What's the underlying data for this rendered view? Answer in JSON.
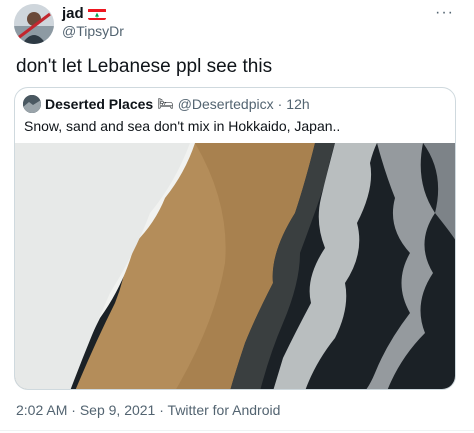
{
  "author": {
    "name": "jad",
    "handle": "@TipsyDr",
    "flag": "lebanon-flag"
  },
  "tweet": {
    "text": "don't let Lebanese ppl see this",
    "more_icon": "more-options-icon"
  },
  "quote": {
    "name": "Deserted Places",
    "emoji": "🛏",
    "handle": "@Desertedpicx",
    "separator": "·",
    "time": "12h",
    "text": "Snow, sand and sea don't mix in Hokkaido, Japan..",
    "image_alt": "aerial photo of snow, sand and sea meeting on a beach"
  },
  "footer": {
    "time": "2:02 AM",
    "sep1": "·",
    "date": "Sep 9, 2021",
    "sep2": "·",
    "source": "Twitter for Android"
  },
  "colors": {
    "flag_red": "#ee161f",
    "flag_green": "#00a651",
    "text_primary": "#0f1419",
    "text_secondary": "#536471",
    "border": "#cfd9de",
    "snow": "#f1f2f0",
    "sand": "#b48d5a",
    "sea": "#1a2025"
  }
}
